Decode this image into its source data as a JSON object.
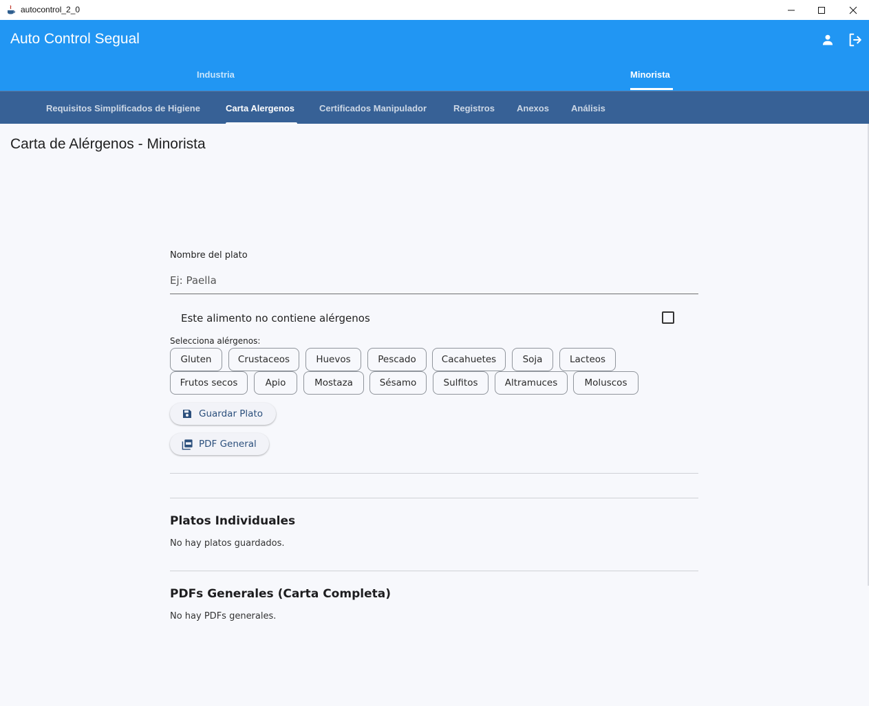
{
  "window": {
    "title": "autocontrol_2_0",
    "icons": {
      "app": "java-cup-icon",
      "minimize": "minimize-icon",
      "maximize": "maximize-icon",
      "close": "close-icon"
    }
  },
  "appbar": {
    "title": "Auto Control Segual",
    "icons": {
      "profile": "person-icon",
      "logout": "logout-icon"
    },
    "tabs": [
      {
        "label": "Industria",
        "active": false
      },
      {
        "label": "Minorista",
        "active": true
      }
    ],
    "colors": {
      "appbar": "#2196f3",
      "subnav": "#376196"
    }
  },
  "subnav": {
    "tabs": [
      {
        "label": "Requisitos Simplificados de Higiene",
        "active": false
      },
      {
        "label": "Carta Alergenos",
        "active": true
      },
      {
        "label": "Certificados Manipulador",
        "active": false
      },
      {
        "label": "Registros",
        "active": false
      },
      {
        "label": "Anexos",
        "active": false
      },
      {
        "label": "Análisis",
        "active": false
      }
    ]
  },
  "page": {
    "title": "Carta de Alérgenos - Minorista"
  },
  "form": {
    "dish_name_label": "Nombre del plato",
    "dish_name_placeholder": "Ej: Paella",
    "dish_name_value": "",
    "no_allergens_label": "Este alimento no contiene alérgenos",
    "no_allergens_checked": false,
    "select_label": "Selecciona alérgenos:",
    "allergens": [
      "Gluten",
      "Crustaceos",
      "Huevos",
      "Pescado",
      "Cacahuetes",
      "Soja",
      "Lacteos",
      "Frutos secos",
      "Apio",
      "Mostaza",
      "Sésamo",
      "Sulfitos",
      "Altramuces",
      "Moluscos"
    ],
    "save_button": {
      "label": "Guardar Plato",
      "icon": "save-icon"
    },
    "pdf_button": {
      "label": "PDF General",
      "icon": "pdf-icon"
    }
  },
  "sections": {
    "individual": {
      "title": "Platos Individuales",
      "empty": "No hay platos guardados."
    },
    "general": {
      "title": "PDFs Generales (Carta Completa)",
      "empty": "No hay PDFs generales."
    }
  }
}
